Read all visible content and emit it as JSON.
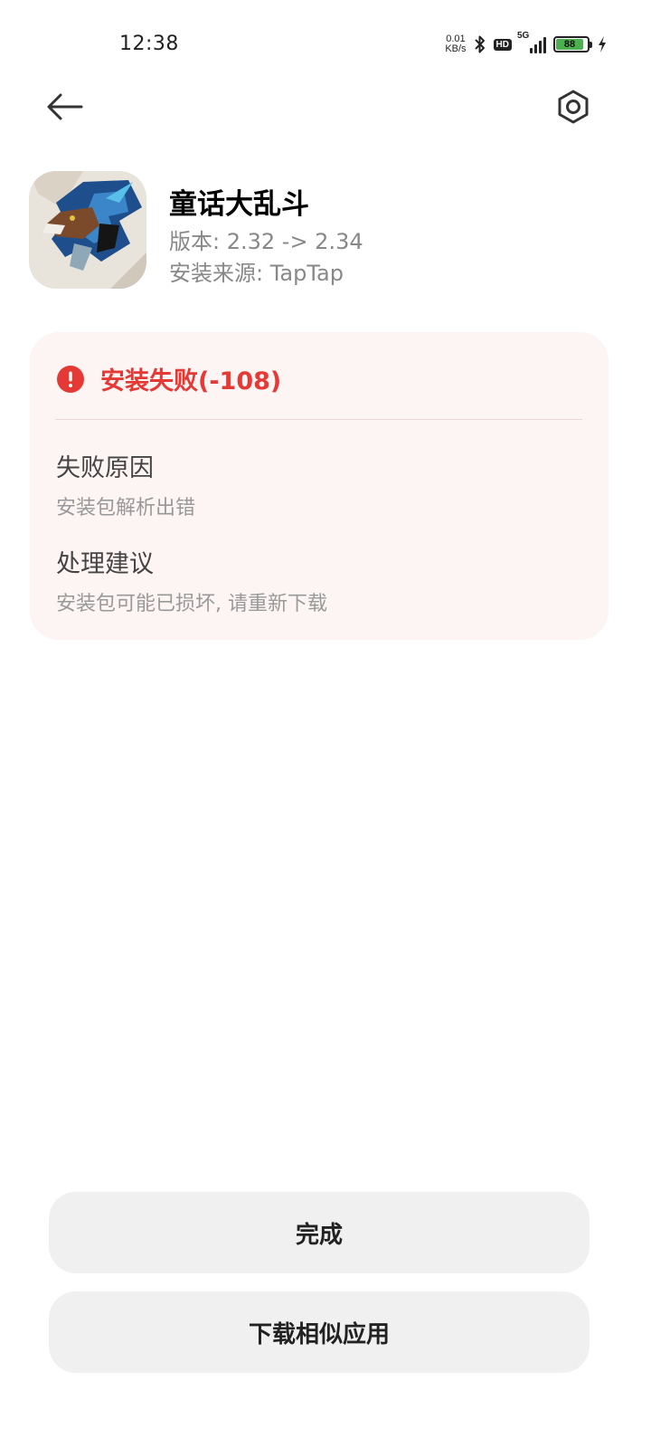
{
  "status_bar": {
    "time": "12:38",
    "net_speed_value": "0.01",
    "net_speed_unit": "KB/s",
    "bluetooth_icon": "bluetooth-icon",
    "hd_label": "HD",
    "network_label": "5G",
    "battery_level": "88",
    "battery_color": "#4caf50",
    "charging_icon": "bolt-icon"
  },
  "header": {
    "back_icon": "arrow-left-icon",
    "settings_icon": "gear-icon"
  },
  "app": {
    "name": "童话大乱斗",
    "version": "版本: 2.32 -> 2.34",
    "source": "安装来源: TapTap"
  },
  "error": {
    "icon": "alert-circle-icon",
    "title": "安装失败(-108)",
    "reason_label": "失败原因",
    "reason_text": "安装包解析出错",
    "suggestion_label": "处理建议",
    "suggestion_text": "安装包可能已损坏, 请重新下载",
    "accent_color": "#e53935"
  },
  "buttons": {
    "done": "完成",
    "download_similar": "下载相似应用"
  }
}
